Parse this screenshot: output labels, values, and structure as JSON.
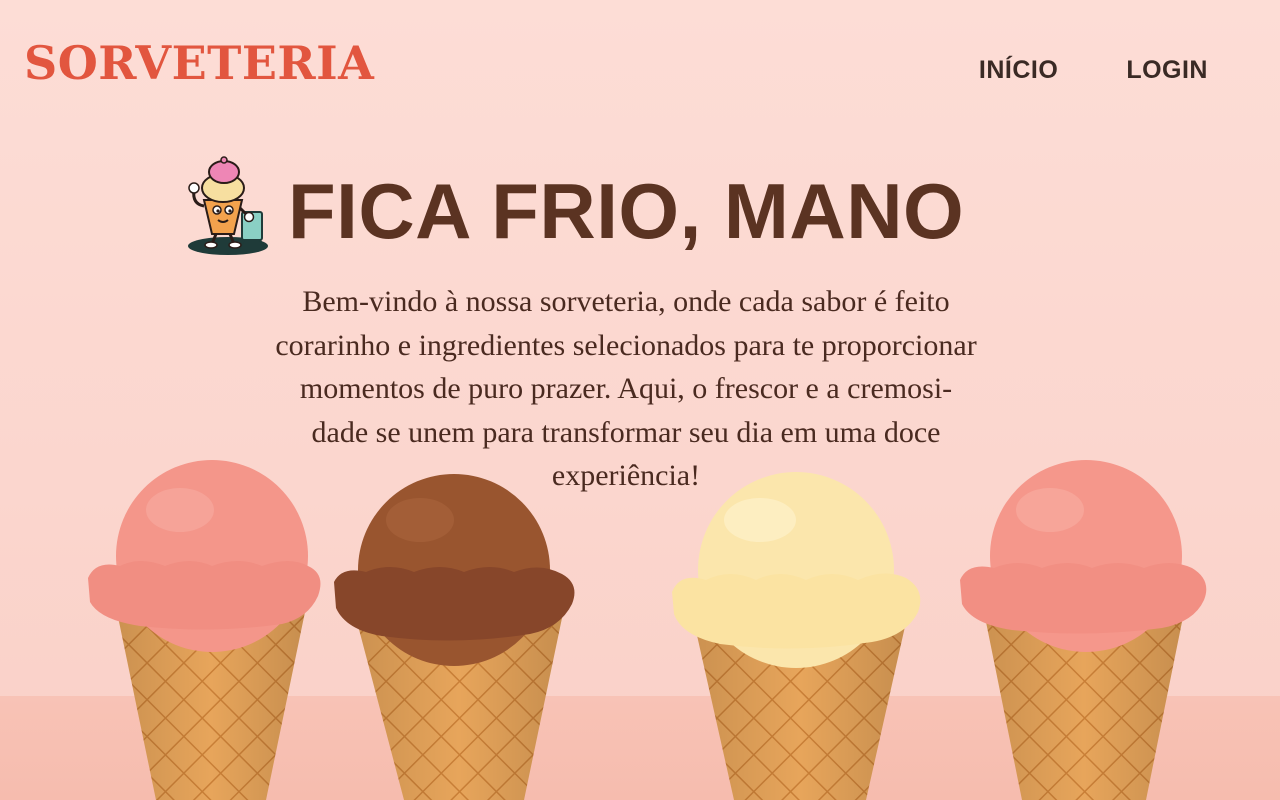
{
  "header": {
    "brand": "SORVETERIA",
    "nav": [
      {
        "label": "INÍCIO"
      },
      {
        "label": "LOGIN"
      }
    ]
  },
  "hero": {
    "mascot_icon": "ice-cream-mascot-icon",
    "title": "FICA FRIO, MANO",
    "description_lines": [
      "Bem-vindo à nossa sorveteria, onde cada sabor é feito",
      "corarinho e ingredientes selecionados para te proporcionar",
      "momentos de puro prazer. Aqui, o frescor e a cremosi-",
      "dade se unem para transformar seu dia em uma doce",
      "experiência!"
    ]
  },
  "cones": [
    {
      "flavor": "strawberry",
      "color": "#f4968a"
    },
    {
      "flavor": "chocolate",
      "color": "#8f4f2c"
    },
    {
      "flavor": "vanilla",
      "color": "#fbe6ac"
    },
    {
      "flavor": "strawberry",
      "color": "#f5978b"
    }
  ],
  "colors": {
    "brand": "#e2563f",
    "title": "#5b3322",
    "text": "#4a2a20",
    "background": "#fcdcd5",
    "cone": "#e6a45a"
  }
}
